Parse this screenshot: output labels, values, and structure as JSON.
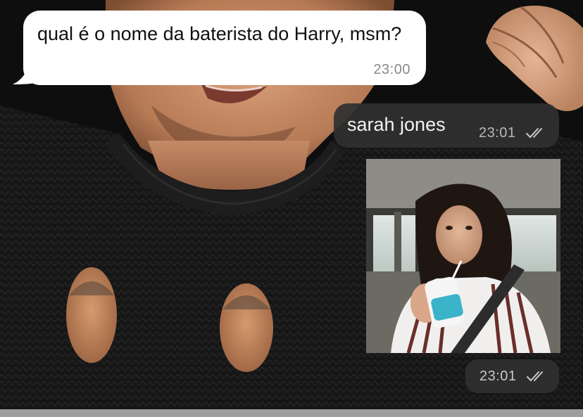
{
  "chat": {
    "messages": [
      {
        "direction": "incoming",
        "text": "qual é o nome da baterista do Harry, msm?",
        "time": "23:00"
      },
      {
        "direction": "outgoing",
        "text": "sarah jones",
        "time": "23:01",
        "status_icon": "double-check-icon"
      },
      {
        "direction": "outgoing",
        "type": "media",
        "time": "23:01",
        "status_icon": "double-check-icon"
      }
    ]
  },
  "colors": {
    "incoming_bubble": "#ffffff",
    "outgoing_bubble": "#303030",
    "wallpaper_base": "#111111",
    "sweater": "#151515",
    "skin": "#c98f6a",
    "cup_accent": "#3bb3c8"
  }
}
